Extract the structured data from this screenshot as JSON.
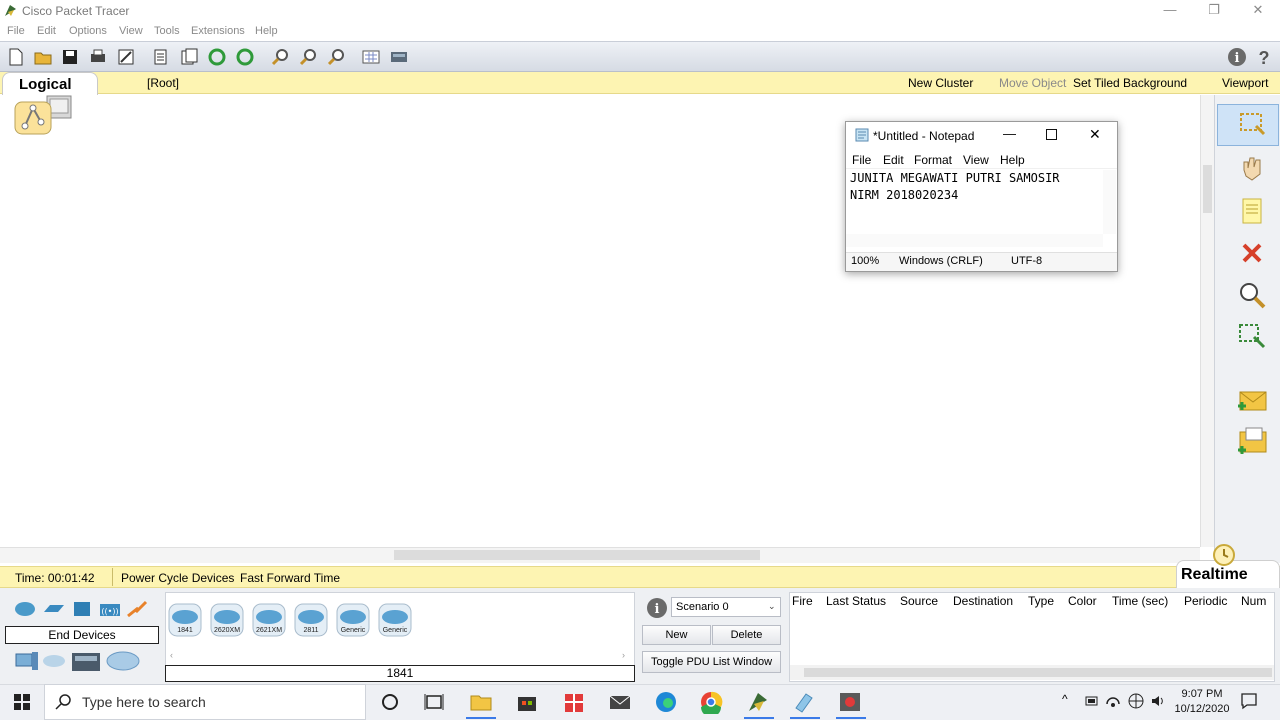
{
  "window": {
    "title": "Cisco Packet Tracer",
    "minimize": "—",
    "maximize": "❐",
    "close": "✕"
  },
  "menu": [
    "File",
    "Edit",
    "Options",
    "View",
    "Tools",
    "Extensions",
    "Help"
  ],
  "logical_bar": {
    "tab": "Logical",
    "root": "[Root]",
    "new_cluster": "New Cluster",
    "move_object": "Move Object",
    "set_tiled_background": "Set Tiled Background",
    "viewport": "Viewport"
  },
  "status_bar": {
    "time": "Time: 00:01:42",
    "power_cycle": "Power Cycle Devices",
    "fast_forward": "Fast Forward Time",
    "mode": "Realtime"
  },
  "devices": {
    "category_label": "End Devices",
    "items": [
      "1841",
      "2620XM",
      "2621XM",
      "2811",
      "Generic",
      "Generic"
    ],
    "selected_name": "1841"
  },
  "scenario": {
    "select_value": "Scenario 0",
    "new_button": "New",
    "delete_button": "Delete",
    "toggle_button": "Toggle PDU List Window"
  },
  "pdu_columns": [
    "Fire",
    "Last Status",
    "Source",
    "Destination",
    "Type",
    "Color",
    "Time (sec)",
    "Periodic",
    "Num"
  ],
  "notepad": {
    "title": "*Untitled - Notepad",
    "menu": [
      "File",
      "Edit",
      "Format",
      "View",
      "Help"
    ],
    "lines": [
      "JUNITA MEGAWATI PUTRI SAMOSIR",
      "NIRM 2018020234"
    ],
    "status": {
      "zoom": "100%",
      "line_ending": "Windows (CRLF)",
      "encoding": "UTF-8"
    }
  },
  "taskbar": {
    "search_placeholder": "Type here to search",
    "time": "9:07 PM",
    "date": "10/12/2020"
  },
  "colors": {
    "yellow_bar": "#fdf4b2",
    "toolbar": "#d6dbe4"
  }
}
